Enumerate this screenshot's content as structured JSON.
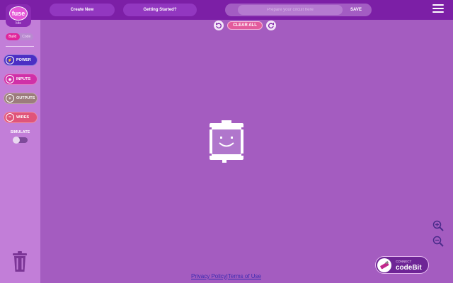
{
  "header": {
    "logo_text": "fuse",
    "logo_subtext": "kits",
    "create_new_label": "Create New",
    "getting_started_label": "Getting Started?",
    "search_placeholder": "Prepare your circuit here",
    "save_label": "SAVE",
    "menu_icon": "hamburger-icon"
  },
  "sidebar": {
    "mode_options": [
      "Build",
      "Code"
    ],
    "active_mode": "Build",
    "categories": [
      {
        "label": "POWER",
        "icon": "power-icon",
        "color": "#4b2fc4"
      },
      {
        "label": "INPUTS",
        "icon": "inputs-icon",
        "color": "#d030a8"
      },
      {
        "label": "OUTPUTS",
        "icon": "outputs-icon",
        "color": "#9c7c7c"
      },
      {
        "label": "WIRES",
        "icon": "wires-icon",
        "color": "#e0547a"
      }
    ],
    "simulate_label": "SIMULATE",
    "simulate_on": false,
    "trash_icon": "trash-icon"
  },
  "canvas": {
    "undo_icon": "undo-icon",
    "clear_all_label": "CLEAR ALL",
    "redo_icon": "redo-icon",
    "component_icon": "codebit-smiley-icon",
    "zoom_in_icon": "zoom-in-icon",
    "zoom_out_icon": "zoom-out-icon"
  },
  "connect": {
    "small_label": "CONNECT",
    "big_label": "codeBit"
  },
  "footer": {
    "privacy_label": "Privacy Policy",
    "separator": "|",
    "terms_label": "Terms of Use"
  },
  "colors": {
    "topbar": "#7c1fa6",
    "sidebar": "#c27ed8",
    "canvas": "#a45cc0",
    "accent_pink": "#e0249b"
  }
}
